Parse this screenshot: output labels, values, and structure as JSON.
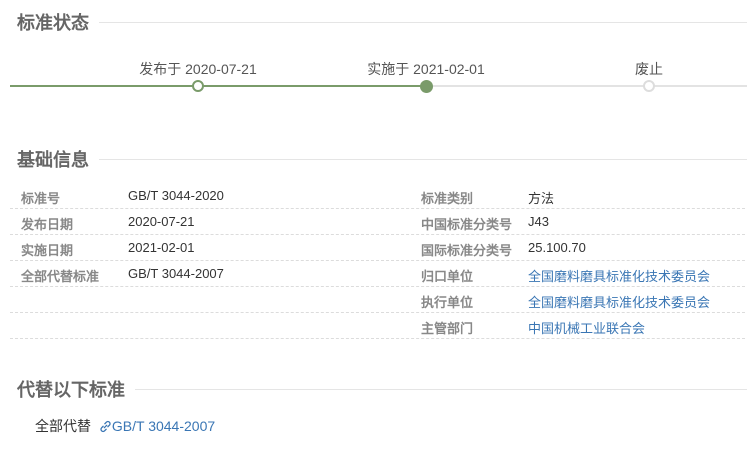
{
  "sections": {
    "status_title": "标准状态",
    "basic_title": "基础信息",
    "replace_title": "代替以下标准"
  },
  "timeline": {
    "progress_fraction": 0.56,
    "steps": [
      {
        "label": "发布于 2020-07-21",
        "state": "done-hollow"
      },
      {
        "label": "实施于 2021-02-01",
        "state": "done-filled"
      },
      {
        "label": "废止",
        "state": "pending"
      }
    ]
  },
  "info": {
    "left": [
      {
        "key": "标准号",
        "value": "GB/T 3044-2020"
      },
      {
        "key": "发布日期",
        "value": "2020-07-21"
      },
      {
        "key": "实施日期",
        "value": "2021-02-01"
      },
      {
        "key": "全部代替标准",
        "value": "GB/T 3044-2007"
      }
    ],
    "right": [
      {
        "key": "标准类别",
        "value": "方法"
      },
      {
        "key": "中国标准分类号",
        "value": "J43"
      },
      {
        "key": "国际标准分类号",
        "value": "25.100.70"
      },
      {
        "key": "归口单位",
        "value": "全国磨料磨具标准化技术委员会"
      },
      {
        "key": "执行单位",
        "value": "全国磨料磨具标准化技术委员会"
      },
      {
        "key": "主管部门",
        "value": "中国机械工业联合会"
      }
    ]
  },
  "replace": {
    "prefix": "全部代替",
    "link_text": "GB/T 3044-2007",
    "icon": "link-icon"
  },
  "colors": {
    "accent_green": "#7a9b6a",
    "link_blue": "#3a76b4",
    "title_gray": "#666666"
  }
}
